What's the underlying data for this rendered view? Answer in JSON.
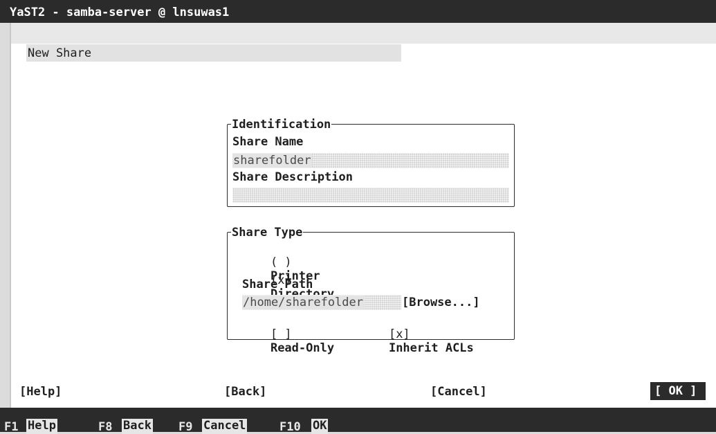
{
  "title_bar": {
    "text": "YaST2 - samba-server @ lnsuwas1"
  },
  "dialog": {
    "heading": "New Share"
  },
  "identification": {
    "legend": "Identification",
    "share_name_label": "Share Name",
    "share_name_value": "sharefolder",
    "share_description_label": "Share Description",
    "share_description_value": ""
  },
  "share_type": {
    "legend": "Share Type",
    "printer_radio": {
      "marker": "( )",
      "label": "Printer",
      "selected": false
    },
    "directory_radio": {
      "marker": "(x)",
      "label": "Directory",
      "selected": true
    },
    "share_path_label": "Share Path",
    "share_path_value": "/home/sharefolder",
    "browse_label": "[Browse...]",
    "read_only": {
      "marker": "[ ]",
      "label": "Read-Only",
      "checked": false
    },
    "inherit_acls": {
      "marker": "[x]",
      "label": "Inherit ACLs",
      "checked": true
    }
  },
  "buttons": {
    "help": "[Help]",
    "back": "[Back]",
    "cancel": "[Cancel]",
    "ok": "[ OK ]"
  },
  "function_keys": [
    {
      "key": "F1",
      "action": "Help"
    },
    {
      "key": "F8",
      "action": "Back"
    },
    {
      "key": "F9",
      "action": "Cancel"
    },
    {
      "key": "F10",
      "action": "OK"
    }
  ]
}
